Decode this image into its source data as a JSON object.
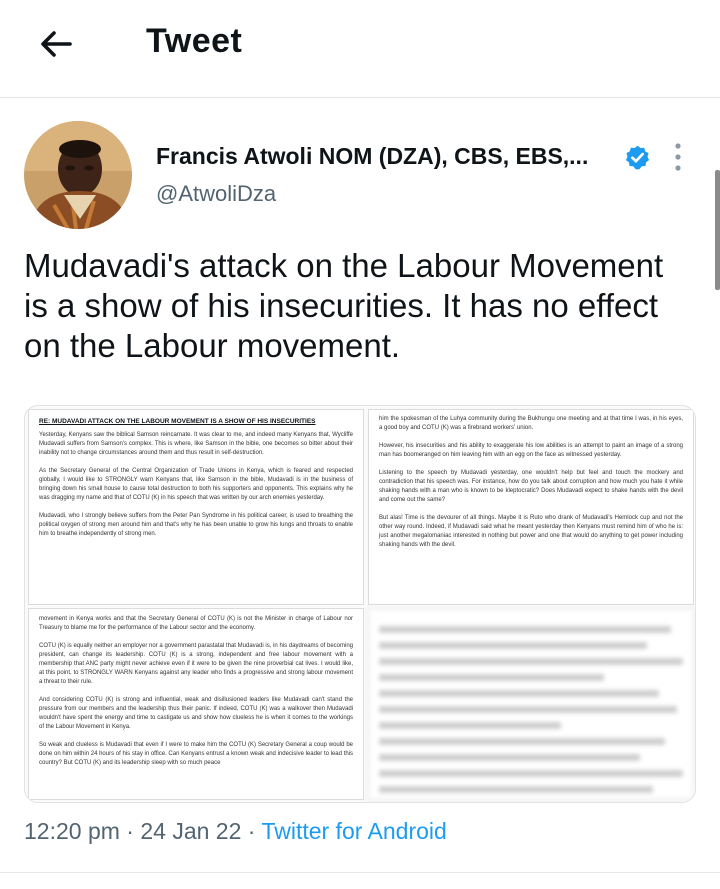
{
  "header": {
    "title": "Tweet",
    "back_icon": "arrow-left-icon"
  },
  "author": {
    "name": "Francis Atwoli NOM (DZA), CBS, EBS,...",
    "handle": "@AtwoliDza",
    "verified_color": "#1d9bf0"
  },
  "tweet": {
    "text": "Mudavadi's attack on the Labour Movement is a show of his insecurities. It has no effect on the Labour movement."
  },
  "document": {
    "title": "RE: MUDAVADI ATTACK ON THE LABOUR MOVEMENT IS A SHOW OF HIS INSECURITIES",
    "page1": [
      "Yesterday, Kenyans saw the biblical Samson reincarnate. It was clear to me, and indeed many Kenyans that, Wycliffe Mudavadi suffers from Samson's complex. This is where, like Samson in the bible, one becomes so bitter about their inability not to change circumstances around them and thus result in self-destruction.",
      "As the Secretary General of the Central Organization of Trade Unions in Kenya, which is feared and respected globally, I would like to STRONGLY warn Kenyans that, like Samson in the bible, Mudavadi is in the business of bringing down his small house to cause total destruction to both his supporters and opponents. This explains why he was dragging my name and that of COTU (K) in his speech that was written by our arch enemies yesterday.",
      "Mudavadi, who I strongly believe suffers from the Peter Pan Syndrome in his political career, is used to breathing the political oxygen of strong men around him and that's why he has been unable to grow his lungs and throats to enable him to breathe independently of strong men."
    ],
    "page2": [
      "him the spokesman of the Luhya community during the Bukhungu one meeting and at that time I was, in his eyes, a good boy and COTU (K) was a firebrand workers' union.",
      "However, his insecurities and his ability to exaggerate his low abilities is an attempt to paint an image of a strong man has boomeranged on him leaving him with an egg on the face as witnessed yesterday.",
      "Listening to the speech by Mudavadi yesterday, one wouldn't help but feel and touch the mockery and contradiction that his speech was. For instance, how do you talk about corruption and how much you hate it while shaking hands with a man who is known to be kleptocratic? Does Mudavadi expect to shake hands with the devil and come out the same?",
      "But alas! Time is the devourer of all things. Maybe it is Ruto who drank of Mudavadi's Hemlock cup and not the other way round. Indeed, if Mudavadi said what he meant yesterday then Kenyans must remind him of who he is: just another megalomaniac interested in nothing but power and one that would do anything to get power including shaking hands with the devil."
    ],
    "page3": [
      "movement in Kenya works and that the Secretary General of COTU (K) is not the Minister in charge of Labour nor Treasury to blame me for the performance of the Labour sector and the economy.",
      "COTU (K) is equally neither an employer nor a government parastatal that Mudavadi is, in his daydreams of becoming president, can change its leadership. COTU (K) is a strong, independent and free labour movement with a membership that ANC party might never achieve even if it were to be given the nine proverbial cat lives. I would like, at this point, to STRONGLY WARN Kenyans against any leader who finds a progressive and strong labour movement a threat to their rule.",
      "And considering COTU (K) is strong and influential, weak and disillusioned leaders like Mudavadi can't stand the pressure from our members and the leadership thus their panic. If indeed, COTU (K) was a walkover then Mudavadi wouldn't have spent the energy and time to castigate us and show how clueless he is when it comes to the workings of the Labour Movement in Kenya.",
      "So weak and clueless is Mudavadi that even if I were to make him the COTU (K) Secretary General a coup would be done on him within 24 hours of his stay in office. Can Kenyans entrust a known weak and indecisive leader to lead this country? But COTU (K) and its leadership sleep with so much peace"
    ],
    "page4_lines": 12
  },
  "meta": {
    "time": "12:20 pm",
    "sep": "·",
    "date": "24 Jan 22",
    "source": "Twitter for Android"
  }
}
